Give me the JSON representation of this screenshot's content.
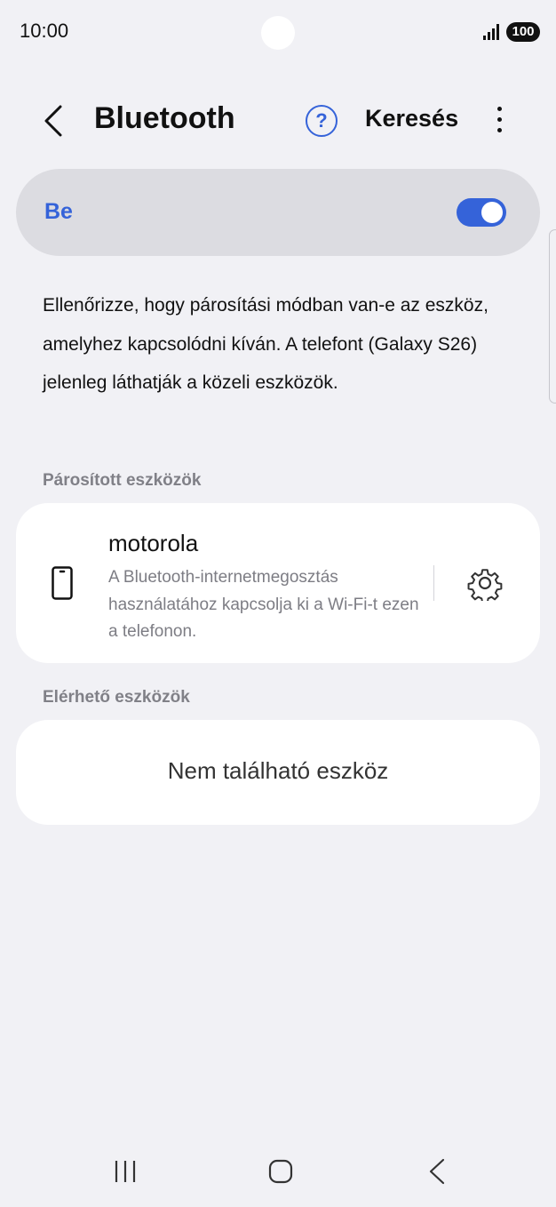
{
  "status_bar": {
    "time": "10:00",
    "battery": "100",
    "icons": [
      "signal-icon",
      "battery-icon"
    ]
  },
  "app_bar": {
    "title": "Bluetooth",
    "help_icon_glyph": "?",
    "search_label": "Keresés",
    "icons": [
      "back-icon",
      "help-icon",
      "more-icon"
    ]
  },
  "toggle": {
    "label": "Be",
    "state": "on",
    "accent_color": "#3563d9"
  },
  "description": "Ellenőrizze, hogy párosítási módban van-e az eszköz, amelyhez kapcsolódni kíván. A telefont (Galaxy S26) jelenleg láthatják a közeli eszközök.",
  "paired": {
    "header": "Párosított eszközök",
    "devices": [
      {
        "name": "motorola",
        "subtitle": "A Bluetooth-internetmegosztás használatához kapcsolja ki a Wi-Fi-t ezen a telefonon.",
        "icon": "phone-icon",
        "action_icon": "gear-icon"
      }
    ]
  },
  "available": {
    "header": "Elérhető eszközök",
    "empty_text": "Nem található eszköz"
  },
  "nav_bar": {
    "icons": [
      "recents-icon",
      "home-icon",
      "nav-back-icon"
    ]
  }
}
